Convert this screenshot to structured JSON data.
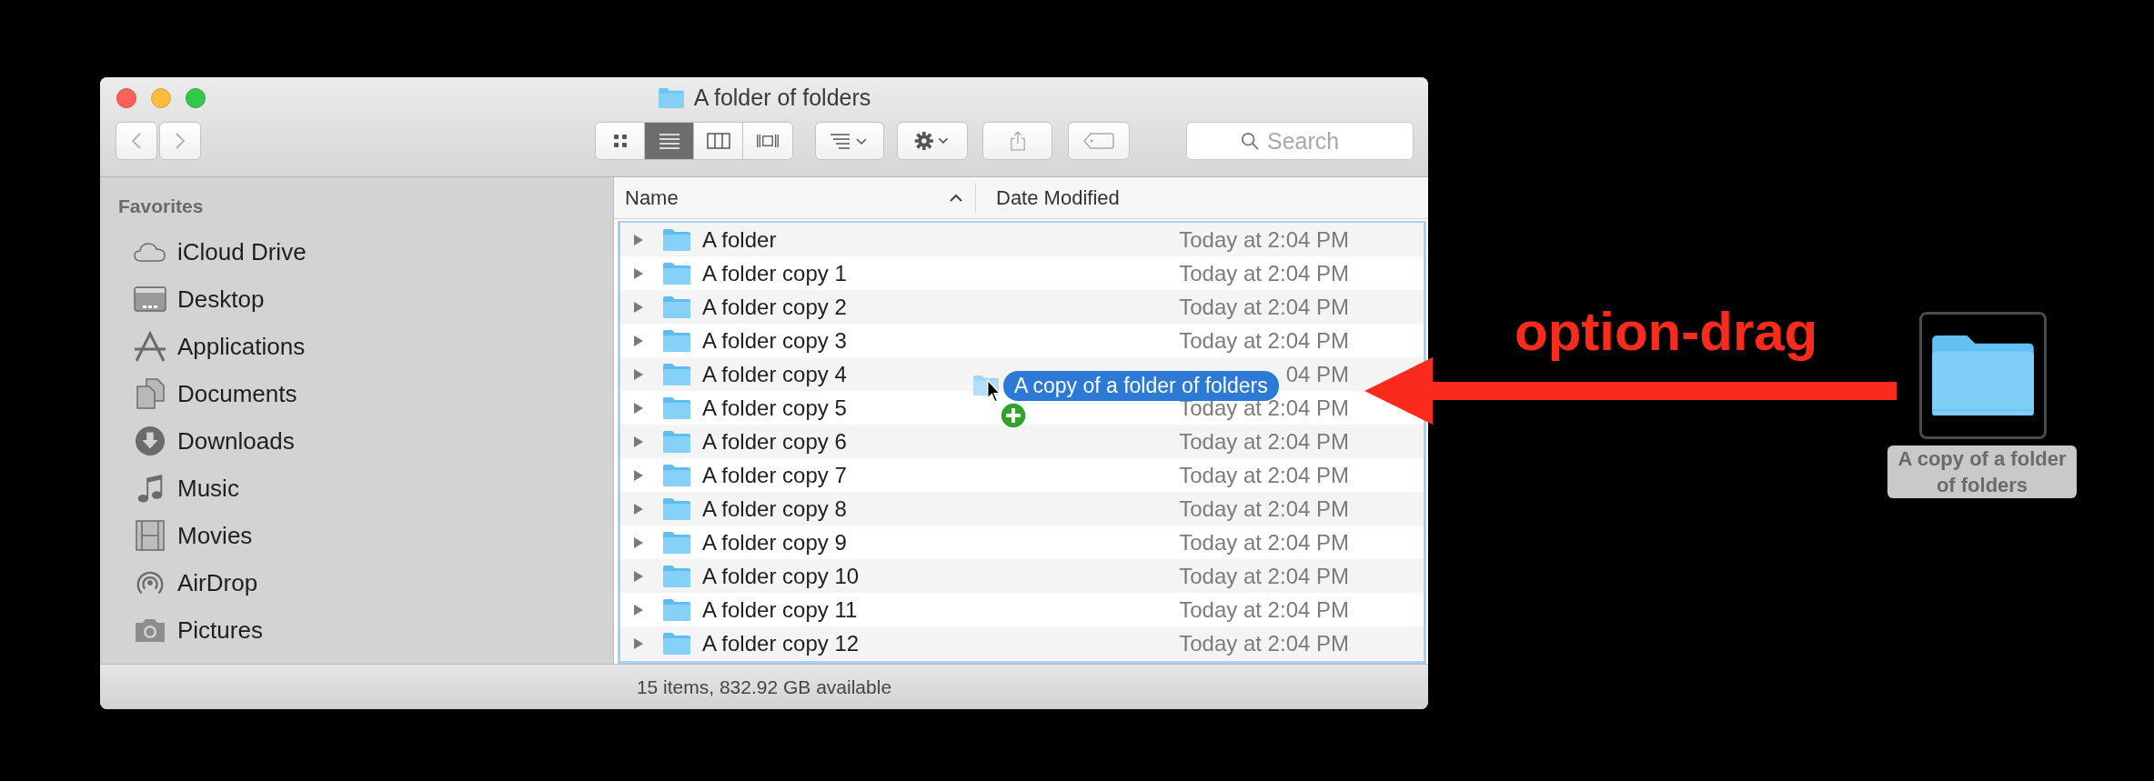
{
  "window": {
    "title": "A folder of folders"
  },
  "toolbar": {
    "view_modes": [
      {
        "selected": false
      },
      {
        "selected": true
      },
      {
        "selected": false
      },
      {
        "selected": false
      }
    ],
    "search": {
      "placeholder": "Search"
    }
  },
  "sidebar": {
    "section": "Favorites",
    "items": [
      {
        "label": "iCloud Drive"
      },
      {
        "label": "Desktop"
      },
      {
        "label": "Applications"
      },
      {
        "label": "Documents"
      },
      {
        "label": "Downloads"
      },
      {
        "label": "Music"
      },
      {
        "label": "Movies"
      },
      {
        "label": "AirDrop"
      },
      {
        "label": "Pictures"
      }
    ]
  },
  "table": {
    "columns": [
      {
        "label": "Name",
        "sorted": true
      },
      {
        "label": "Date Modified",
        "sorted": false
      }
    ],
    "rows": [
      {
        "name": "A folder",
        "date": "Today at 2:04 PM"
      },
      {
        "name": "A folder copy 1",
        "date": "Today at 2:04 PM"
      },
      {
        "name": "A folder copy 2",
        "date": "Today at 2:04 PM"
      },
      {
        "name": "A folder copy 3",
        "date": "Today at 2:04 PM"
      },
      {
        "name": "A folder copy 4",
        "date": "04 PM"
      },
      {
        "name": "A folder copy 5",
        "date": "Today at 2:04 PM"
      },
      {
        "name": "A folder copy 6",
        "date": "Today at 2:04 PM"
      },
      {
        "name": "A folder copy 7",
        "date": "Today at 2:04 PM"
      },
      {
        "name": "A folder copy 8",
        "date": "Today at 2:04 PM"
      },
      {
        "name": "A folder copy 9",
        "date": "Today at 2:04 PM"
      },
      {
        "name": "A folder copy 10",
        "date": "Today at 2:04 PM"
      },
      {
        "name": "A folder copy 11",
        "date": "Today at 2:04 PM"
      },
      {
        "name": "A folder copy 12",
        "date": "Today at 2:04 PM"
      }
    ]
  },
  "drag": {
    "label": "A copy of a folder of folders"
  },
  "status_bar": "15 items, 832.92 GB available",
  "annotation": {
    "text": "option-drag"
  },
  "desktop_item": {
    "label": "A copy of a folder of folders",
    "selected": true
  }
}
